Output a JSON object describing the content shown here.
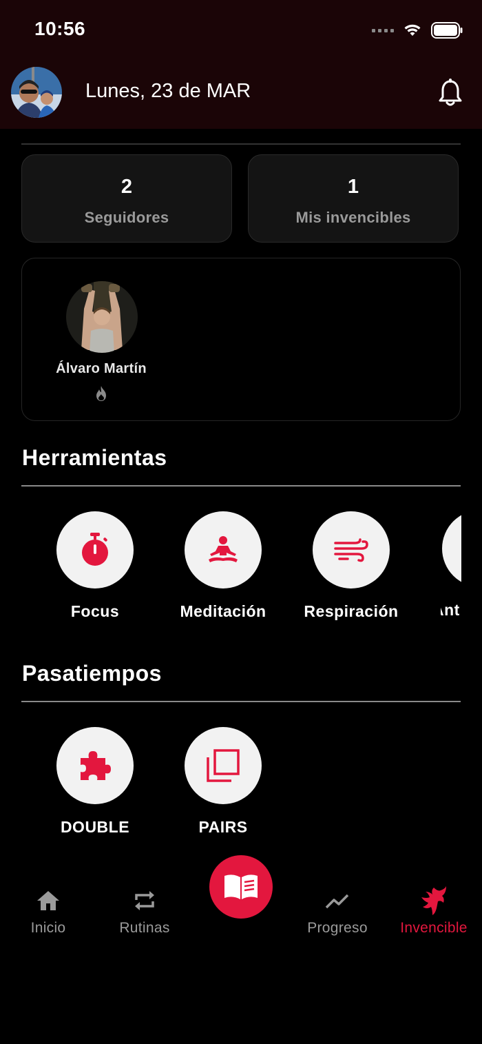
{
  "status_bar": {
    "time": "10:56"
  },
  "header": {
    "date": "Lunes, 23 de MAR"
  },
  "stats": [
    {
      "value": "2",
      "label": "Seguidores"
    },
    {
      "value": "1",
      "label": "Mis invencibles"
    }
  ],
  "friends": [
    {
      "name": "Álvaro Martín"
    }
  ],
  "herramientas": {
    "title": "Herramientas",
    "items": [
      {
        "label": "Focus",
        "icon": "stopwatch-icon"
      },
      {
        "label": "Meditación",
        "icon": "meditation-icon"
      },
      {
        "label": "Respiración",
        "icon": "wind-icon"
      },
      {
        "label": "Ant",
        "icon": "partial-tool-icon"
      }
    ]
  },
  "pasatiempos": {
    "title": "Pasatiempos",
    "items": [
      {
        "label": "DOUBLE",
        "icon": "puzzle-icon"
      },
      {
        "label": "PAIRS",
        "icon": "cards-icon"
      }
    ]
  },
  "nav": [
    {
      "label": "Inicio",
      "icon": "home-icon"
    },
    {
      "label": "Rutinas",
      "icon": "repeat-icon"
    },
    {
      "label": "",
      "icon": "book-icon"
    },
    {
      "label": "Progreso",
      "icon": "trending-icon"
    },
    {
      "label": "Invencible",
      "icon": "phoenix-icon"
    }
  ],
  "colors": {
    "accent": "#e3173e",
    "header_bg": "#1b0507",
    "card_bg": "#141414"
  }
}
